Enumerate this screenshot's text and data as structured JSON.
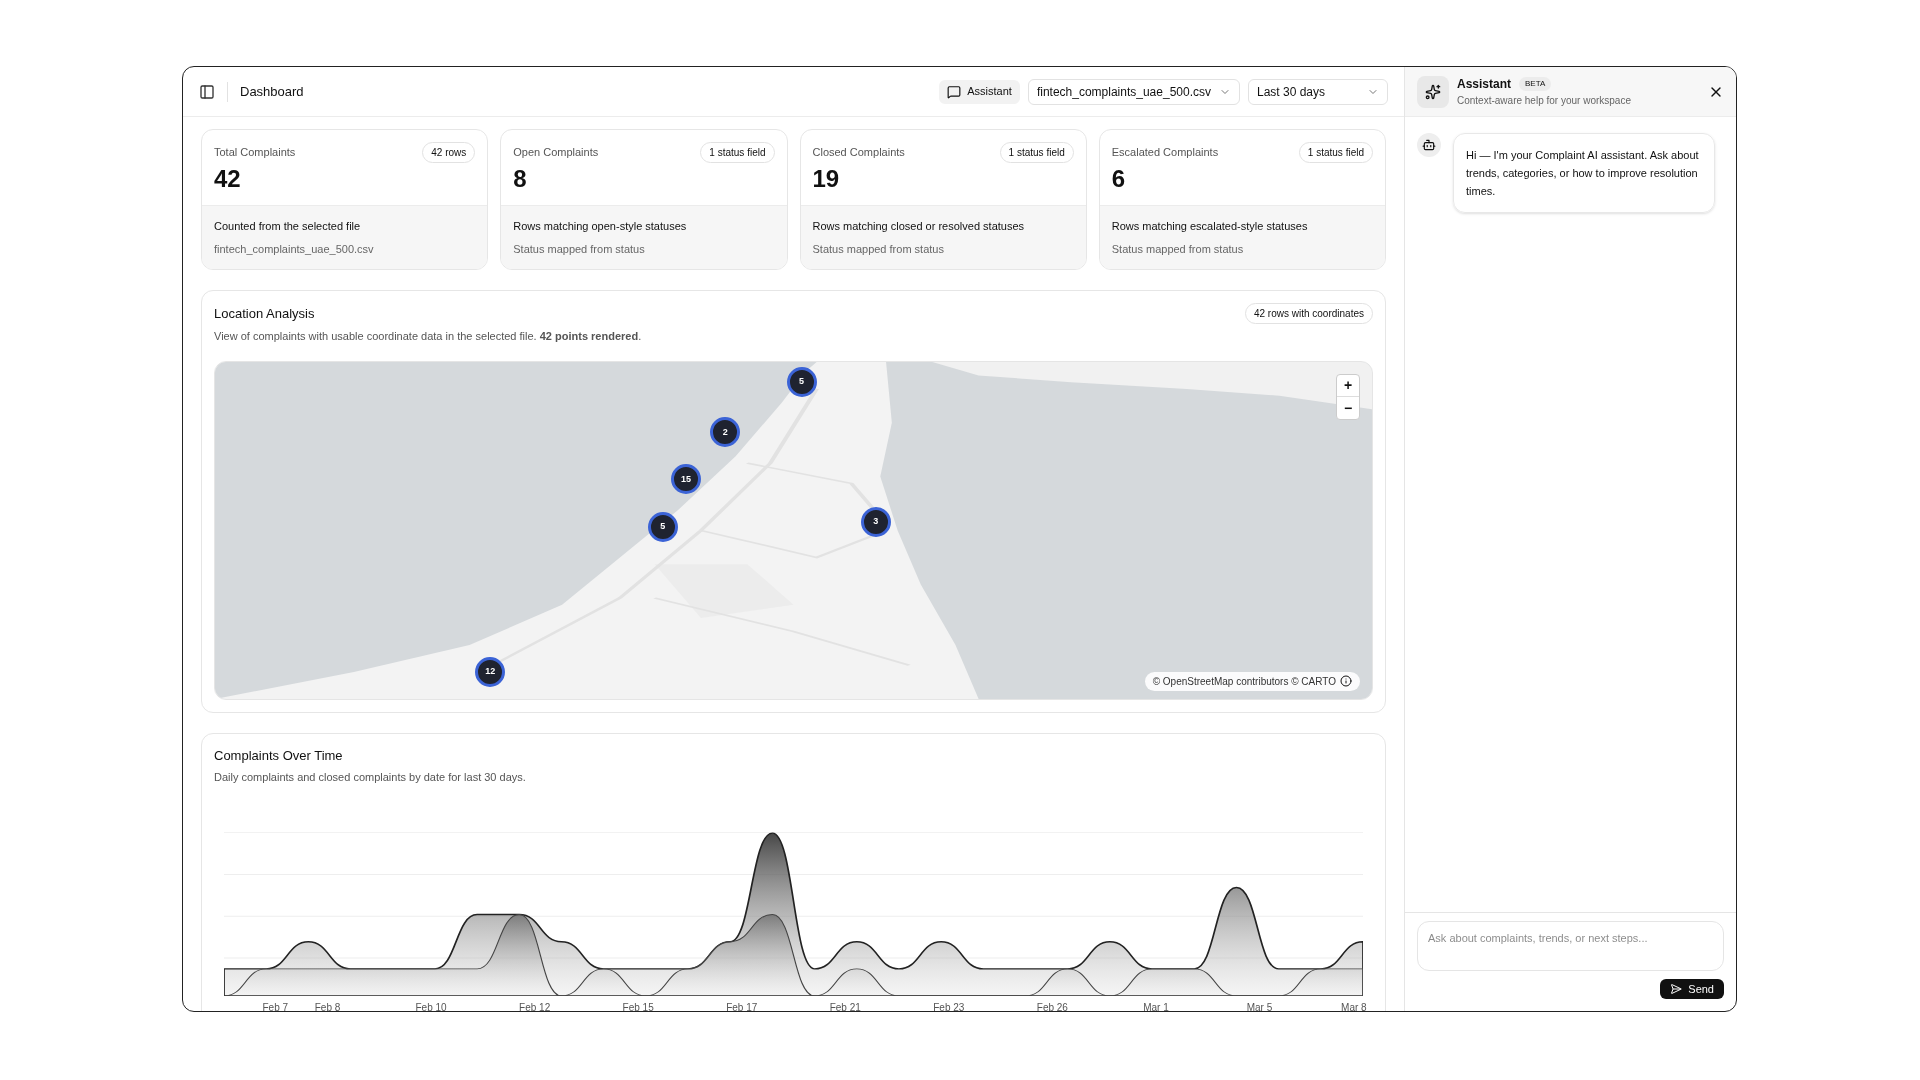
{
  "header": {
    "title": "Dashboard",
    "assistant_button": "Assistant",
    "file_select": "fintech_complaints_uae_500.csv",
    "range_select": "Last 30 days"
  },
  "stats": [
    {
      "label": "Total Complaints",
      "badge": "42 rows",
      "value": "42",
      "note": "Counted from the selected file",
      "sub": "fintech_complaints_uae_500.csv"
    },
    {
      "label": "Open Complaints",
      "badge": "1 status field",
      "value": "8",
      "note": "Rows matching open-style statuses",
      "sub": "Status mapped from status"
    },
    {
      "label": "Closed Complaints",
      "badge": "1 status field",
      "value": "19",
      "note": "Rows matching closed or resolved statuses",
      "sub": "Status mapped from status"
    },
    {
      "label": "Escalated Complaints",
      "badge": "1 status field",
      "value": "6",
      "note": "Rows matching escalated-style statuses",
      "sub": "Status mapped from status"
    }
  ],
  "location": {
    "title": "Location Analysis",
    "description": "View of complaints with usable coordinate data in the selected file. **42 points rendered**.",
    "badge": "42 rows with coordinates",
    "map": {
      "kind": "picture",
      "clusters": [
        "5",
        "2",
        "15",
        "5",
        "3",
        "12"
      ],
      "zoom_in": "+",
      "zoom_out": "−",
      "attribution": "© OpenStreetMap contributors © CARTO"
    }
  },
  "timeline": {
    "title": "Complaints Over Time",
    "description": "Daily complaints and closed complaints by date for last 30 days.",
    "x_labels": [
      "Feb 7",
      "Feb 8",
      "Feb 10",
      "Feb 12",
      "Feb 15",
      "Feb 17",
      "Feb 21",
      "Feb 23",
      "Feb 26",
      "Mar 1",
      "Mar 5",
      "Mar 8"
    ]
  },
  "assistant": {
    "title": "Assistant",
    "badge": "BETA",
    "subtitle": "Context-aware help for your workspace",
    "messages": [
      {
        "kind": "bot",
        "text": "Hi — I'm your Complaint AI assistant. Ask about trends, categories, or how to improve resolution times."
      }
    ],
    "input": {
      "placeholder": "Ask about complaints, trends, or next steps..."
    },
    "send": "Send"
  }
}
